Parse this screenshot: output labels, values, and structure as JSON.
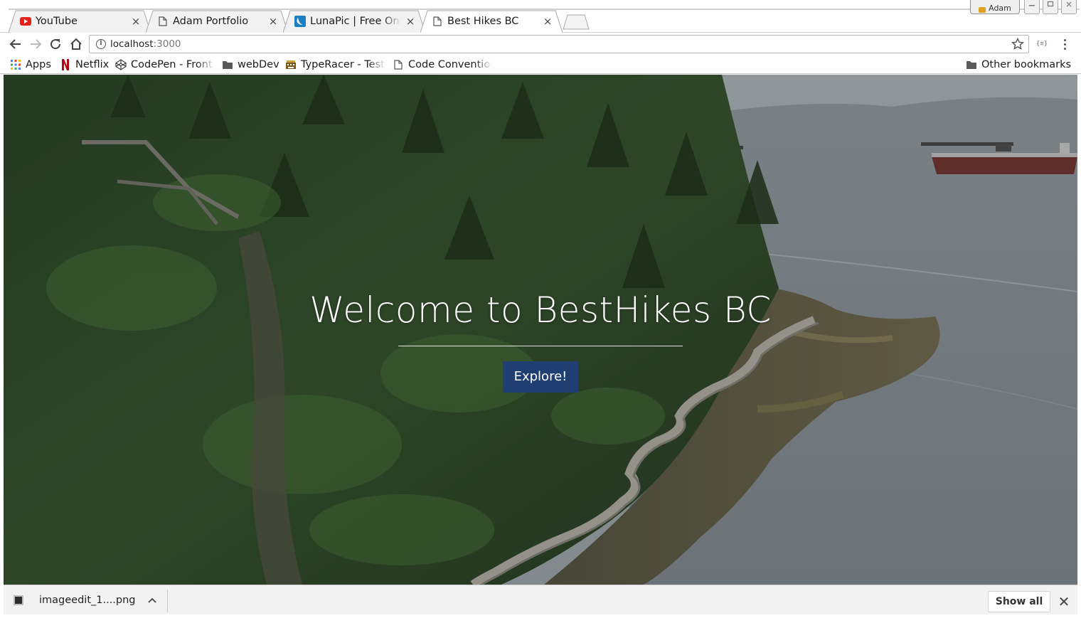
{
  "browser": {
    "tabs": [
      {
        "title": "YouTube",
        "favicon": "youtube-icon",
        "active": false
      },
      {
        "title": "Adam Portfolio",
        "favicon": "page-icon",
        "active": false
      },
      {
        "title": "LunaPic | Free Online Photo Editor",
        "favicon": "lunapic-icon",
        "active": false
      },
      {
        "title": "Best Hikes BC",
        "favicon": "page-icon",
        "active": true
      }
    ],
    "profile_name": "Adam",
    "close_glyph": "×"
  },
  "toolbar": {
    "url_host": "localhost",
    "url_port": ":3000",
    "info_glyph": "i",
    "extension_label": "{≡}"
  },
  "bookmarks": {
    "items": [
      {
        "label": "Apps",
        "icon": "apps-grid-icon"
      },
      {
        "label": "Netflix",
        "icon": "netflix-icon"
      },
      {
        "label": "CodePen - Front End Developer Playground",
        "icon": "codepen-icon"
      },
      {
        "label": "webDev",
        "icon": "folder-icon"
      },
      {
        "label": "TypeRacer - Test your typing speed",
        "icon": "typeracer-icon"
      },
      {
        "label": "Code Conventions",
        "icon": "page-icon"
      }
    ],
    "other": "Other bookmarks"
  },
  "page": {
    "hero_title": "Welcome to BestHikes BC",
    "cta_label": "Explore!",
    "cta_color": "#1f3f73"
  },
  "downloads": {
    "file_name": "imageedit_1....png",
    "show_all": "Show all",
    "close_glyph": "✕"
  },
  "colors": {
    "youtube_red": "#e62117",
    "netflix_red": "#b1060f",
    "lunapic_blue": "#1f7fc4",
    "apps_colors": [
      "#4285f4",
      "#ea4335",
      "#fbbc05",
      "#34a853"
    ]
  }
}
